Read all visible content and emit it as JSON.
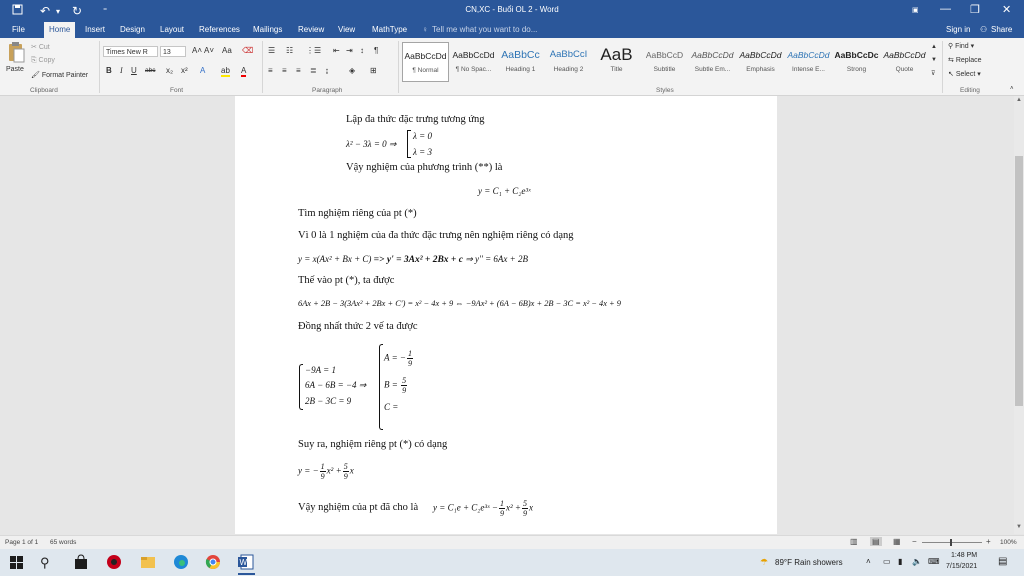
{
  "titlebar": {
    "title": "CN,XC - Buổi OL 2 - Word",
    "user_initials": "PP"
  },
  "tabs": [
    "File",
    "Home",
    "Insert",
    "Design",
    "Layout",
    "References",
    "Mailings",
    "Review",
    "View",
    "MathType"
  ],
  "tell_me": "Tell me what you want to do...",
  "sign_in": "Sign in",
  "share": "Share",
  "clipboard": {
    "paste": "Paste",
    "cut": "Cut",
    "copy": "Copy",
    "format_painter": "Format Painter",
    "label": "Clipboard"
  },
  "font": {
    "name": "Times New R",
    "size": "13",
    "label": "Font"
  },
  "paragraph": {
    "label": "Paragraph"
  },
  "styles": {
    "label": "Styles",
    "items": [
      {
        "preview": "AaBbCcDd",
        "name": "¶ Normal"
      },
      {
        "preview": "AaBbCcDd",
        "name": "¶ No Spac..."
      },
      {
        "preview": "AaBbCc",
        "name": "Heading 1"
      },
      {
        "preview": "AaBbCcI",
        "name": "Heading 2"
      },
      {
        "preview": "AaB",
        "name": "Title"
      },
      {
        "preview": "AaBbCcD",
        "name": "Subtitle"
      },
      {
        "preview": "AaBbCcDd",
        "name": "Subtle Em..."
      },
      {
        "preview": "AaBbCcDd",
        "name": "Emphasis"
      },
      {
        "preview": "AaBbCcDd",
        "name": "Intense E..."
      },
      {
        "preview": "AaBbCcDc",
        "name": "Strong"
      },
      {
        "preview": "AaBbCcDd",
        "name": "Quote"
      }
    ]
  },
  "editing": {
    "find": "Find",
    "replace": "Replace",
    "select": "Select",
    "label": "Editing"
  },
  "document": {
    "l1": "Lập đa thức đặc trưng tương ứng",
    "l2_lhs": "λ² − 3λ = 0 ⇒",
    "l2_a": "λ = 0",
    "l2_b": "λ = 3",
    "l3": "Vậy nghiệm của phương trình (**) là",
    "l4": "y = C₁ + C₂e³ˣ",
    "l5": "Tìm nghiệm riêng của pt (*)",
    "l6": "Vì 0 là 1 nghiệm  của đa thức đặc trưng nên nghiệm riêng có dạng",
    "l7_a": "y = x(Ax² + Bx + C) ",
    "l7_b": "=> y' = 3Ax² + 2Bx + c",
    "l7_c": " ⇒ y'' = 6Ax + 2B",
    "l8": "Thế vào pt (*), ta được",
    "l9": "6Ax + 2B − 3(3Ax² + 2Bx + C') = x² − 4x + 9 ⇔ −9Ax² + (6A − 6B)x + 2B − 3C = x² − 4x + 9",
    "l10": "Đồng nhất thức 2 vế ta được",
    "sys1": "−9A = 1",
    "sys2": "6A − 6B = −4 ⇒",
    "sys3": "2B − 3C = 9",
    "solA": "A = −",
    "solA_n": "1",
    "solA_d": "9",
    "solB": "B = ",
    "solB_n": "5",
    "solB_d": "9",
    "solC": "C =",
    "l11": "Suy ra, nghiệm riêng pt (*) có dạng",
    "l12_a": "y = −",
    "l12_f1n": "1",
    "l12_f1d": "9",
    "l12_b": "x² +",
    "l12_f2n": "5",
    "l12_f2d": "9",
    "l12_c": "x",
    "l13": "Vậy nghiệm của pt đã cho là",
    "l13_a": "y = C₁e + C₂e³ˣ −",
    "l13_f1n": "1",
    "l13_f1d": "9",
    "l13_b": "x² +",
    "l13_f2n": "5",
    "l13_f2d": "9",
    "l13_c": "x"
  },
  "status": {
    "page": "Page 1 of 1",
    "words": "65 words",
    "zoom": "100%"
  },
  "taskbar": {
    "weather": "89°F  Rain showers",
    "time": "1:48 PM",
    "date": "7/15/2021"
  },
  "colors": {
    "accent": "#2b579a",
    "ribbon_bg": "#f3f3f3",
    "taskbar_bg": "#dfe7ee"
  }
}
